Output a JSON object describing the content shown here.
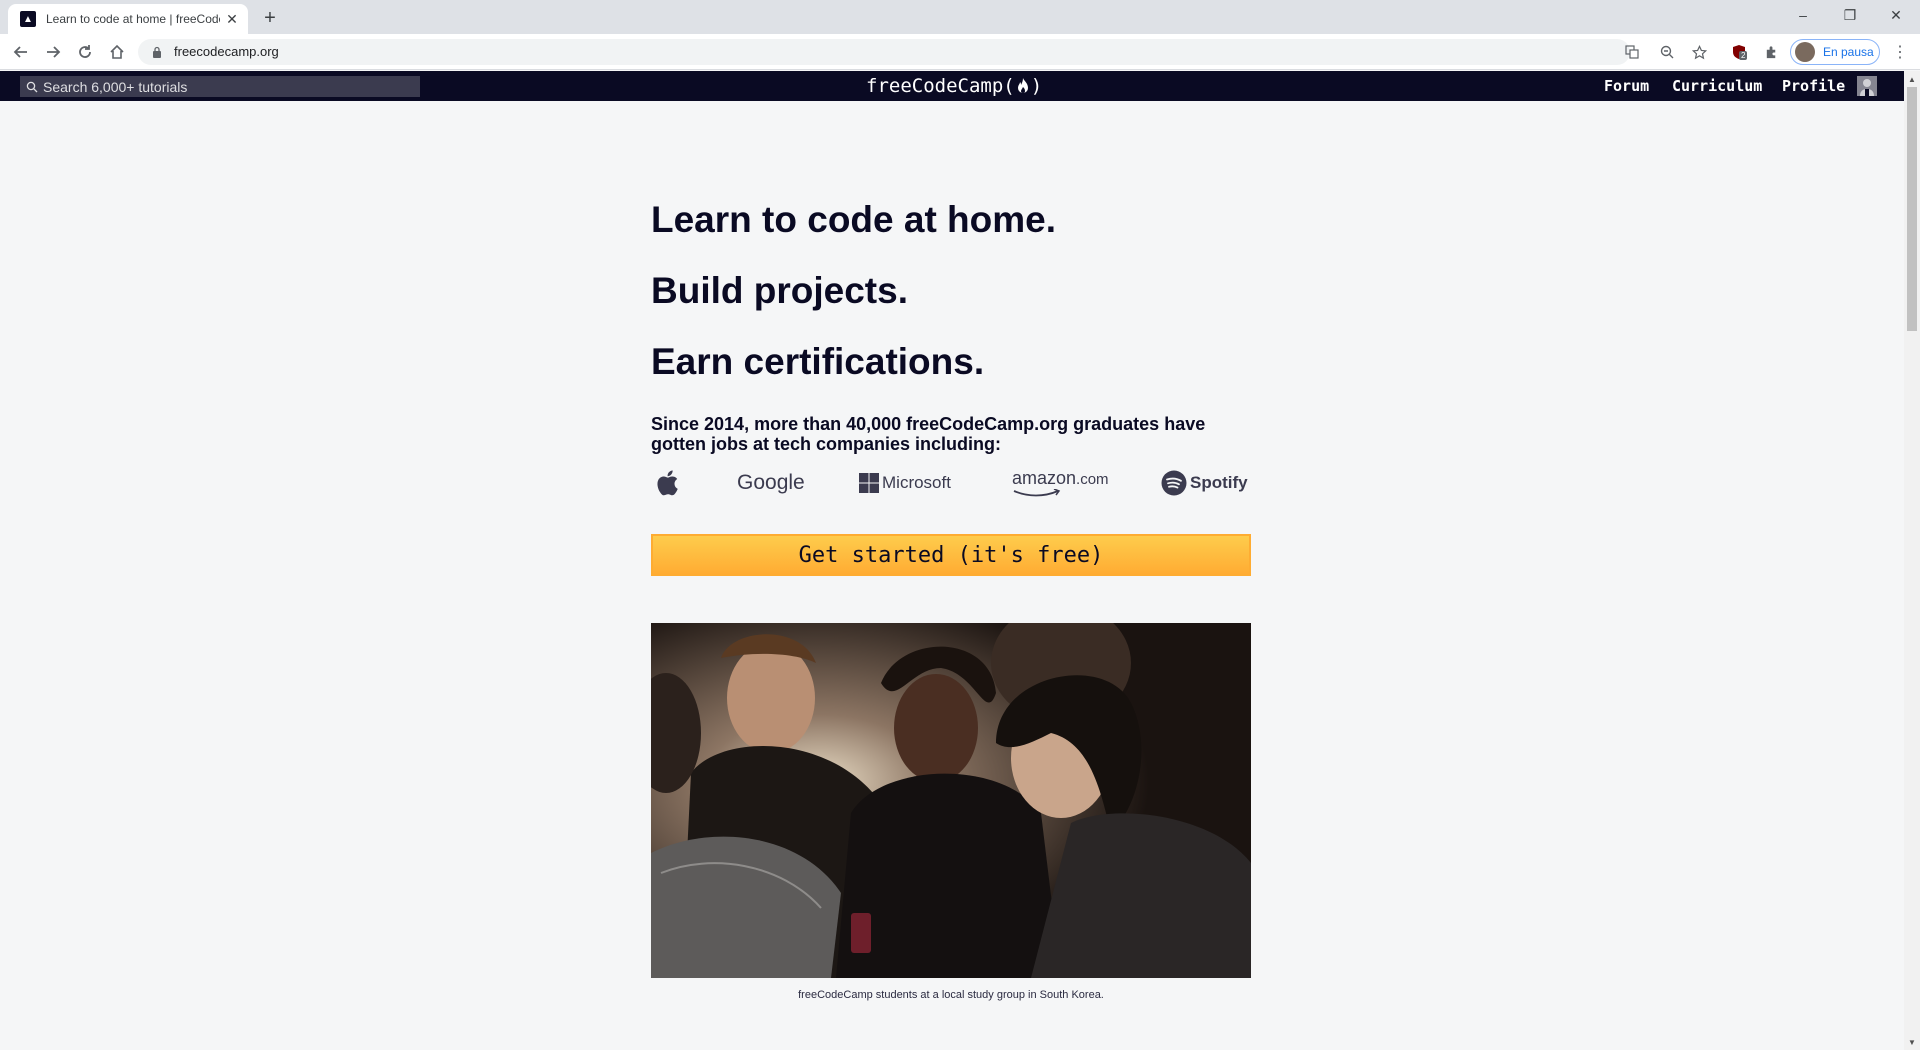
{
  "browser": {
    "tab": {
      "title": "Learn to code at home | freeCodeCamp.org",
      "favicon": "freecodecamp-icon",
      "close": "✕"
    },
    "new_tab": "+",
    "window_controls": {
      "minimize": "–",
      "restore": "❐",
      "close": "✕"
    },
    "toolbar": {
      "url": "freecodecamp.org",
      "profile_label": "En pausa",
      "ext_badge": "2"
    }
  },
  "site_nav": {
    "search_placeholder": "Search 6,000+ tutorials",
    "logo_text_left": "freeCodeCamp(",
    "logo_text_right": ")",
    "links": {
      "forum": "Forum",
      "curriculum": "Curriculum",
      "profile": "Profile"
    }
  },
  "hero": {
    "headline_1": "Learn to code at home.",
    "headline_2": "Build projects.",
    "headline_3": "Earn certifications.",
    "lead": "Since 2014, more than 40,000 freeCodeCamp.org graduates have gotten jobs at tech companies including:",
    "brands": {
      "google": "Google",
      "microsoft": "Microsoft",
      "amazon": "amazon",
      "amazon_suffix": ".com",
      "spotify": "Spotify"
    },
    "cta_label": "Get started (it's free)",
    "caption": "freeCodeCamp students at a local study group in South Korea."
  },
  "colors": {
    "nav_bg": "#0a0a23",
    "page_bg": "#f5f6f7",
    "cta_yellow": "#feac32",
    "text_dark": "#0a0a23"
  }
}
